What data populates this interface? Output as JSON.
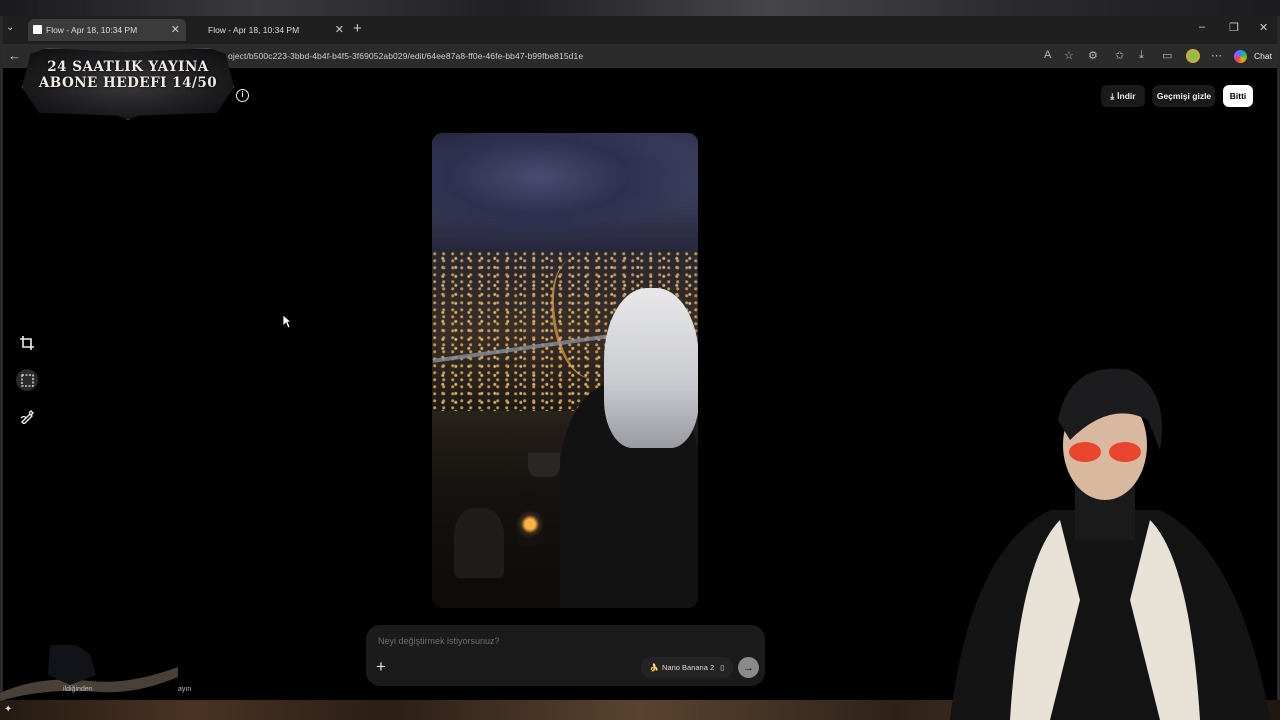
{
  "browser": {
    "tabs": [
      {
        "title": "Flow - Apr 18, 10:34 PM",
        "active": true
      },
      {
        "title": "Flow - Apr 18, 10:34 PM",
        "active": false
      }
    ],
    "url": "oject/b500c223-3bbd-4b4f-b4f5-3f69052ab029/edit/64ee87a8-ff0e-46fe-bb47-b99fbe815d1e",
    "chat_label": "Chat"
  },
  "overlay": {
    "banner_line1": "24 SAATLIK YAYINA",
    "banner_line2": "ABONE HEDEFI 14/50",
    "crow_caption_left": "ildiğinden",
    "crow_caption_right": "ayın"
  },
  "header": {
    "download_label": "İndir",
    "hide_history_label": "Geçmişi gizle",
    "done_label": "Bitti"
  },
  "tools": [
    {
      "icon": "crop-icon"
    },
    {
      "icon": "select-icon"
    },
    {
      "icon": "draw-icon"
    }
  ],
  "prompt": {
    "placeholder": "Neyi değiştirmek istiyorsunuz?",
    "model_label": "Nano Banana 2",
    "model_icon": "banana-icon"
  },
  "colors": {
    "background": "#000000",
    "done_button": "#ffffff",
    "prompt_bg": "#1b1b1b"
  }
}
